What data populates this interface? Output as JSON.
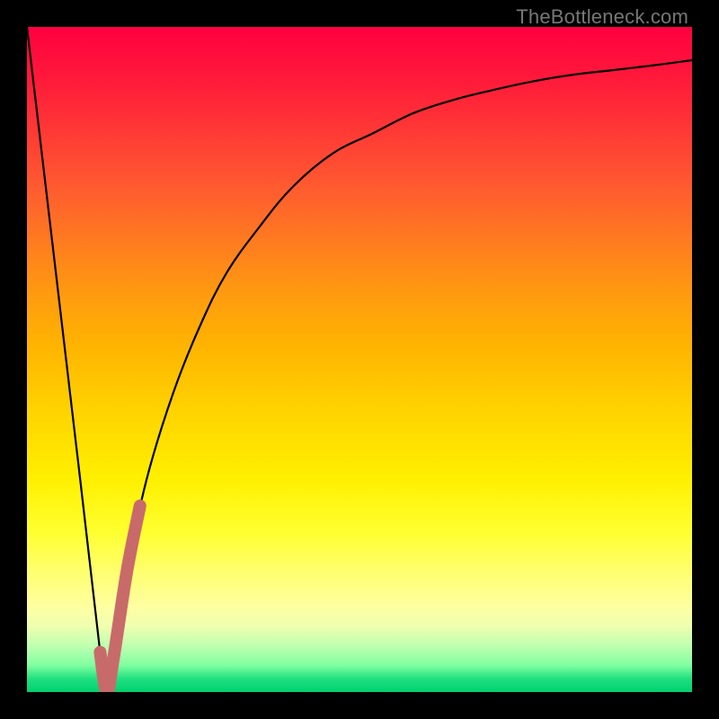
{
  "watermark": "TheBottleneck.com",
  "colors": {
    "frame": "#000000",
    "curve": "#000000",
    "highlight": "#c96a6a"
  },
  "chart_data": {
    "type": "line",
    "title": "",
    "xlabel": "",
    "ylabel": "",
    "xlim": [
      0,
      100
    ],
    "ylim": [
      0,
      100
    ],
    "grid": false,
    "legend": false,
    "annotations": [
      {
        "text": "TheBottleneck.com",
        "pos": "top-right"
      }
    ],
    "series": [
      {
        "name": "bottleneck-curve",
        "x": [
          0,
          4,
          8,
          11,
          12,
          13,
          15,
          18,
          22,
          26,
          30,
          35,
          40,
          46,
          52,
          58,
          64,
          70,
          76,
          82,
          88,
          94,
          100
        ],
        "values": [
          100,
          66,
          32,
          6,
          0,
          5,
          18,
          32,
          45,
          55,
          63,
          70,
          76,
          81,
          84,
          87,
          89,
          90.5,
          91.8,
          92.8,
          93.5,
          94.2,
          95
        ]
      },
      {
        "name": "highlight-segment",
        "x": [
          11,
          12,
          13,
          15,
          17
        ],
        "values": [
          6,
          0,
          5,
          18,
          28
        ]
      }
    ]
  }
}
